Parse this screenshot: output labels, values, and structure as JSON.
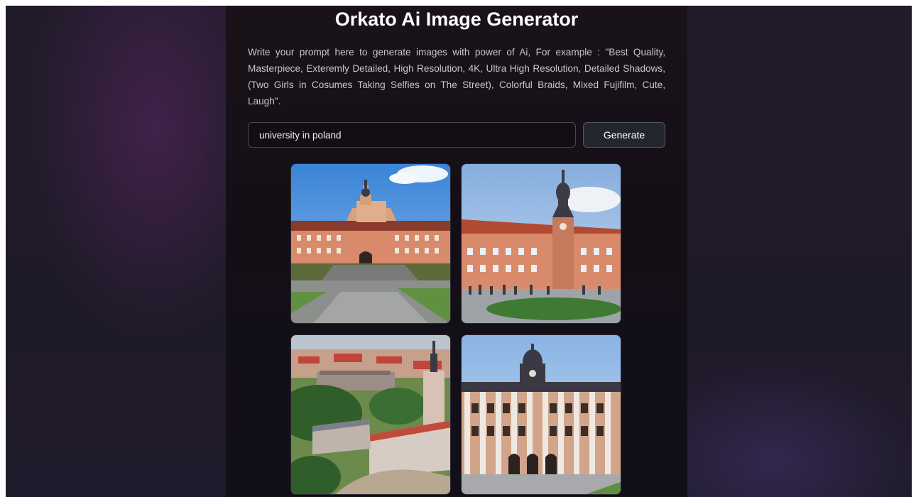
{
  "page": {
    "title": "Orkato Ai Image Generator",
    "description": "Write your prompt here to generate images with power of Ai, For example : \"Best Quality, Masterpiece, Exteremly Detailed, High Resolution, 4K, Ultra High Resolution, Detailed Shadows, (Two Girls in Cosumes Taking Selfies on The Street), Colorful Braids, Mixed Fujifilm, Cute, Laugh\"."
  },
  "prompt": {
    "value": "university in poland"
  },
  "generate_button": {
    "label": "Generate"
  },
  "colors": {
    "page_background": "#201b2a",
    "panel_background": "#150f17",
    "button_background": "#23262c"
  },
  "gallery": {
    "images": [
      {
        "subject": "pink-baroque-palace-university"
      },
      {
        "subject": "red-roof-building-with-clock-tower"
      },
      {
        "subject": "aerial-view-of-campus-with-tower"
      },
      {
        "subject": "white-column-facade-with-clock-tower"
      }
    ]
  }
}
